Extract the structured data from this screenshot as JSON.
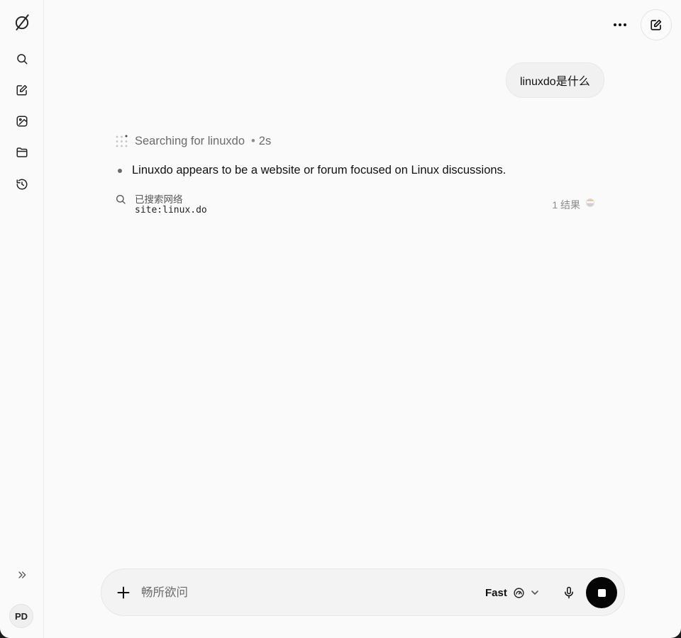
{
  "sidebar": {
    "items": [
      {
        "name": "logo",
        "icon": "slash-circle-logo-icon"
      },
      {
        "name": "search",
        "icon": "search-icon"
      },
      {
        "name": "new-chat",
        "icon": "edit-icon"
      },
      {
        "name": "imagine",
        "icon": "image-sticker-icon"
      },
      {
        "name": "projects",
        "icon": "folder-icon"
      },
      {
        "name": "history",
        "icon": "history-icon"
      }
    ],
    "expand_icon": "chevrons-right-icon",
    "avatar_initials": "PD"
  },
  "header": {
    "more_icon": "ellipsis-icon",
    "new_chat_icon": "edit-icon"
  },
  "conversation": {
    "user_message": "linuxdo是什么",
    "status": {
      "label": "Searching for linuxdo",
      "separator": "•",
      "elapsed": "2s"
    },
    "bullets": [
      "Linuxdo appears to be a website or forum focused on Linux discussions."
    ],
    "search_result": {
      "title": "已搜索网络",
      "query": "site:linux.do",
      "count": "1 结果"
    }
  },
  "composer": {
    "placeholder": "畅所欲问",
    "value": "",
    "model_label": "Fast",
    "model_icon": "speed-gauge-icon",
    "add_icon": "plus-icon",
    "mic_icon": "microphone-icon",
    "stop_icon": "stop-icon"
  },
  "colors": {
    "background": "#fafafa",
    "stop_button": "#050505",
    "muted_text": "#6b6b6b"
  }
}
